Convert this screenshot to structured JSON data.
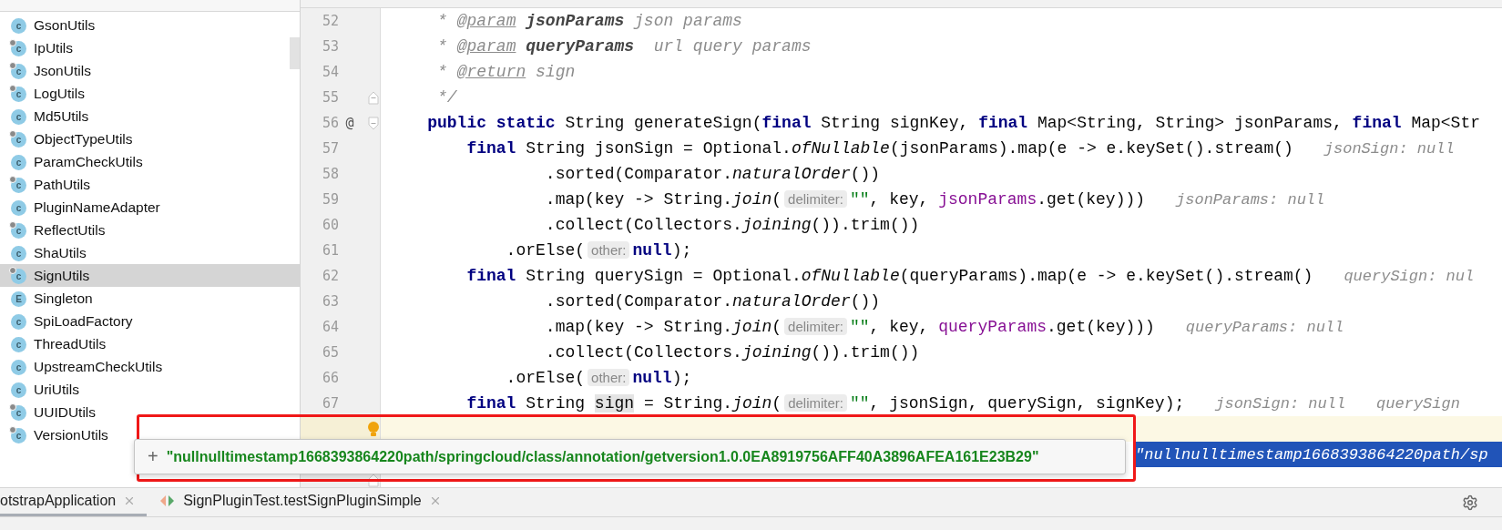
{
  "project_tree": {
    "items": [
      {
        "name": "GsonUtils",
        "badge": "c",
        "final": false,
        "selected": false
      },
      {
        "name": "IpUtils",
        "badge": "c",
        "final": true,
        "selected": false
      },
      {
        "name": "JsonUtils",
        "badge": "c",
        "final": true,
        "selected": false
      },
      {
        "name": "LogUtils",
        "badge": "c",
        "final": true,
        "selected": false
      },
      {
        "name": "Md5Utils",
        "badge": "c",
        "final": false,
        "selected": false
      },
      {
        "name": "ObjectTypeUtils",
        "badge": "c",
        "final": true,
        "selected": false
      },
      {
        "name": "ParamCheckUtils",
        "badge": "c",
        "final": false,
        "selected": false
      },
      {
        "name": "PathUtils",
        "badge": "c",
        "final": true,
        "selected": false
      },
      {
        "name": "PluginNameAdapter",
        "badge": "c",
        "final": false,
        "selected": false
      },
      {
        "name": "ReflectUtils",
        "badge": "c",
        "final": true,
        "selected": false
      },
      {
        "name": "ShaUtils",
        "badge": "c",
        "final": false,
        "selected": false
      },
      {
        "name": "SignUtils",
        "badge": "c",
        "final": true,
        "selected": true
      },
      {
        "name": "Singleton",
        "badge": "E",
        "final": false,
        "selected": false
      },
      {
        "name": "SpiLoadFactory",
        "badge": "c",
        "final": false,
        "selected": false
      },
      {
        "name": "ThreadUtils",
        "badge": "c",
        "final": false,
        "selected": false
      },
      {
        "name": "UpstreamCheckUtils",
        "badge": "c",
        "final": false,
        "selected": false
      },
      {
        "name": "UriUtils",
        "badge": "c",
        "final": false,
        "selected": false
      },
      {
        "name": "UUIDUtils",
        "badge": "c",
        "final": true,
        "selected": false
      },
      {
        "name": "VersionUtils",
        "badge": "c",
        "final": true,
        "selected": false
      }
    ]
  },
  "editor": {
    "lines": [
      {
        "kind": "code",
        "number": "52",
        "segments": [
          {
            "kind": "doc",
            "text": "     * "
          },
          {
            "kind": "doc-tag",
            "text": "@param"
          },
          {
            "kind": "doc-name",
            "text": " jsonParams"
          },
          {
            "kind": "doc",
            "text": " json params"
          }
        ]
      },
      {
        "kind": "code",
        "number": "53",
        "segments": [
          {
            "kind": "doc",
            "text": "     * "
          },
          {
            "kind": "doc-tag",
            "text": "@param"
          },
          {
            "kind": "doc-name",
            "text": " queryParams"
          },
          {
            "kind": "doc",
            "text": "  url query params"
          }
        ]
      },
      {
        "kind": "code",
        "number": "54",
        "segments": [
          {
            "kind": "doc",
            "text": "     * "
          },
          {
            "kind": "doc-tag",
            "text": "@return"
          },
          {
            "kind": "doc",
            "text": " sign"
          }
        ]
      },
      {
        "kind": "code",
        "number": "55",
        "fold_close": true,
        "segments": [
          {
            "kind": "doc",
            "text": "     */"
          }
        ]
      },
      {
        "kind": "code",
        "number": "56",
        "mark": "@",
        "fold_open": true,
        "segments": [
          {
            "kind": "keyword",
            "text": "    public static "
          },
          {
            "kind": "plain",
            "text": "String generateSign("
          },
          {
            "kind": "keyword",
            "text": "final "
          },
          {
            "kind": "plain",
            "text": "String signKey, "
          },
          {
            "kind": "keyword",
            "text": "final "
          },
          {
            "kind": "plain",
            "text": "Map<String, String> jsonParams, "
          },
          {
            "kind": "keyword",
            "text": "final "
          },
          {
            "kind": "plain",
            "text": "Map<Str"
          }
        ]
      },
      {
        "kind": "code",
        "number": "57",
        "segments": [
          {
            "kind": "keyword",
            "text": "        final "
          },
          {
            "kind": "plain",
            "text": "String jsonSign = Optional."
          },
          {
            "kind": "italic",
            "text": "ofNullable"
          },
          {
            "kind": "plain",
            "text": "(jsonParams).map(e -> e.keySet().stream()"
          }
        ],
        "values": [
          "jsonSign: null"
        ]
      },
      {
        "kind": "code",
        "number": "58",
        "segments": [
          {
            "kind": "plain",
            "text": "                .sorted(Comparator."
          },
          {
            "kind": "italic",
            "text": "naturalOrder"
          },
          {
            "kind": "plain",
            "text": "())"
          }
        ]
      },
      {
        "kind": "code",
        "number": "59",
        "segments": [
          {
            "kind": "plain",
            "text": "                .map(key -> String."
          },
          {
            "kind": "italic",
            "text": "join"
          },
          {
            "kind": "plain",
            "text": "("
          },
          {
            "kind": "hint",
            "text": "delimiter:"
          },
          {
            "kind": "string",
            "text": "\"\""
          },
          {
            "kind": "plain",
            "text": ", key, "
          },
          {
            "kind": "param",
            "text": "jsonParams"
          },
          {
            "kind": "plain",
            "text": ".get(key)))"
          }
        ],
        "values": [
          "jsonParams: null"
        ]
      },
      {
        "kind": "code",
        "number": "60",
        "segments": [
          {
            "kind": "plain",
            "text": "                .collect(Collectors."
          },
          {
            "kind": "italic",
            "text": "joining"
          },
          {
            "kind": "plain",
            "text": "()).trim())"
          }
        ]
      },
      {
        "kind": "code",
        "number": "61",
        "segments": [
          {
            "kind": "plain",
            "text": "            .orElse("
          },
          {
            "kind": "hint",
            "text": "other:"
          },
          {
            "kind": "keyword",
            "text": "null"
          },
          {
            "kind": "plain",
            "text": ");"
          }
        ]
      },
      {
        "kind": "code",
        "number": "62",
        "segments": [
          {
            "kind": "keyword",
            "text": "        final "
          },
          {
            "kind": "plain",
            "text": "String querySign = Optional."
          },
          {
            "kind": "italic",
            "text": "ofNullable"
          },
          {
            "kind": "plain",
            "text": "(queryParams).map(e -> e.keySet().stream()"
          }
        ],
        "values": [
          "querySign: nul"
        ]
      },
      {
        "kind": "code",
        "number": "63",
        "segments": [
          {
            "kind": "plain",
            "text": "                .sorted(Comparator."
          },
          {
            "kind": "italic",
            "text": "naturalOrder"
          },
          {
            "kind": "plain",
            "text": "())"
          }
        ]
      },
      {
        "kind": "code",
        "number": "64",
        "segments": [
          {
            "kind": "plain",
            "text": "                .map(key -> String."
          },
          {
            "kind": "italic",
            "text": "join"
          },
          {
            "kind": "plain",
            "text": "("
          },
          {
            "kind": "hint",
            "text": "delimiter:"
          },
          {
            "kind": "string",
            "text": "\"\""
          },
          {
            "kind": "plain",
            "text": ", key, "
          },
          {
            "kind": "param",
            "text": "queryParams"
          },
          {
            "kind": "plain",
            "text": ".get(key)))"
          }
        ],
        "values": [
          "queryParams: null"
        ]
      },
      {
        "kind": "code",
        "number": "65",
        "segments": [
          {
            "kind": "plain",
            "text": "                .collect(Collectors."
          },
          {
            "kind": "italic",
            "text": "joining"
          },
          {
            "kind": "plain",
            "text": "()).trim())"
          }
        ]
      },
      {
        "kind": "code",
        "number": "66",
        "segments": [
          {
            "kind": "plain",
            "text": "            .orElse("
          },
          {
            "kind": "hint",
            "text": "other:"
          },
          {
            "kind": "keyword",
            "text": "null"
          },
          {
            "kind": "plain",
            "text": ");"
          }
        ]
      },
      {
        "kind": "code",
        "number": "67",
        "segments": [
          {
            "kind": "keyword",
            "text": "        final "
          },
          {
            "kind": "plain",
            "text": "String "
          },
          {
            "kind": "usage",
            "text": "sign"
          },
          {
            "kind": "plain",
            "text": " = String."
          },
          {
            "kind": "italic",
            "text": "join"
          },
          {
            "kind": "plain",
            "text": "("
          },
          {
            "kind": "hint",
            "text": "delimiter:"
          },
          {
            "kind": "string",
            "text": "\"\""
          },
          {
            "kind": "plain",
            "text": ", jsonSign, querySign, signKey);"
          }
        ],
        "values": [
          "jsonSign: null",
          "querySign"
        ]
      },
      {
        "kind": "current"
      },
      {
        "kind": "selection",
        "text": "\"nullnulltimestamp1668393864220path/sp"
      },
      {
        "kind": "closing",
        "fold_close": true
      }
    ]
  },
  "value_popup": {
    "prefix": "+",
    "value": "\"nullnulltimestamp1668393864220path/springcloud/class/annotation/getversion1.0.0EA8919756AFF40A3896AFEA161E23B29\""
  },
  "bottom_tabs": [
    {
      "label": "otstrapApplication",
      "selected": true,
      "kind": "app"
    },
    {
      "label": "SignPluginTest.testSignPluginSimple",
      "selected": false,
      "kind": "test"
    }
  ]
}
